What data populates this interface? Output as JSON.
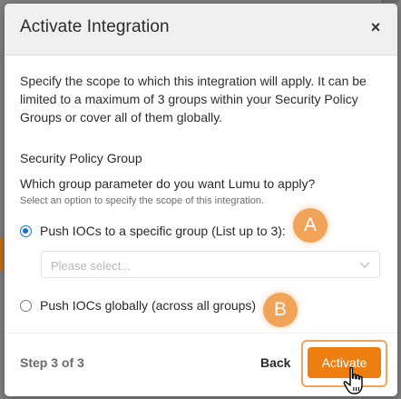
{
  "modal": {
    "title": "Activate Integration",
    "close_label": "×",
    "description": "Specify the scope to which this integration will apply. It can be limited to a maximum of 3 groups within your Security Policy Groups or cover all of them globally.",
    "section_heading": "Security Policy Group",
    "question": "Which group parameter do you want Lumu to apply?",
    "hint": "Select an option to specify the scope of this integration."
  },
  "options": [
    {
      "label": "Push IOCs to a specific group (List up to 3):",
      "selected": true
    },
    {
      "label": "Push IOCs globally (across all groups)",
      "selected": false
    }
  ],
  "group_select": {
    "placeholder": "Please select..."
  },
  "annotations": {
    "badge_a": "A",
    "badge_b": "B"
  },
  "footer": {
    "step_label": "Step 3 of 3",
    "back_label": "Back",
    "activate_label": "Activate"
  },
  "colors": {
    "accent": "#ee7e10",
    "badge": "#f2a35a",
    "radio_selected": "#1a6ed8",
    "header_bg": "#f0f0f0"
  },
  "icons": {
    "close": "close-icon",
    "chevron": "chevron-down-icon",
    "cursor": "hand-pointer-icon"
  }
}
